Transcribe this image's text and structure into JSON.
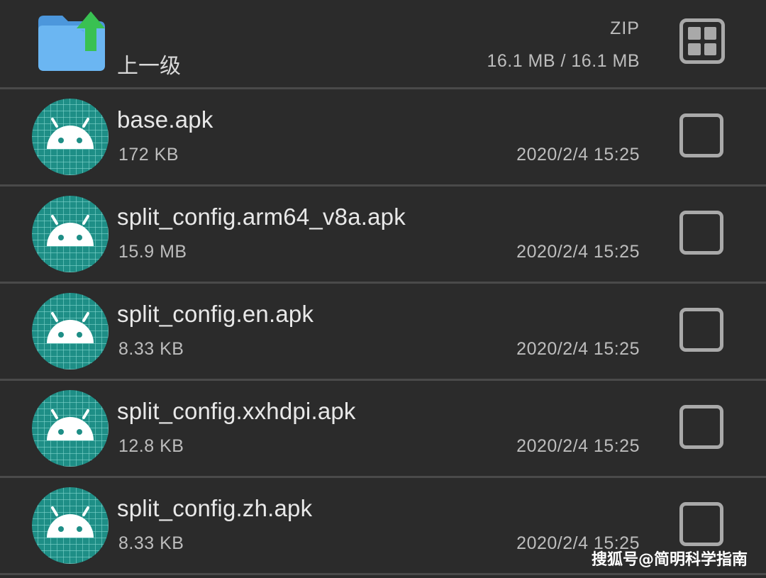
{
  "colors": {
    "background": "#2b2b2b",
    "divider": "#4a4a4a",
    "apk_icon_bg": "#1e8e86",
    "apk_icon_grid": "#7fd3cb",
    "android_head": "#ffffff",
    "folder": "#5aa9ec",
    "upload_arrow": "#39c152",
    "checkbox": "#a9a9a9"
  },
  "header": {
    "label": "上一级",
    "icon": "folder-up-icon",
    "type": "ZIP",
    "size": "16.1 MB / 16.1 MB",
    "view_toggle_icon": "grid-view-icon"
  },
  "files": [
    {
      "name": "base.apk",
      "size": "172 KB",
      "date": "2020/2/4  15:25",
      "icon": "android-apk-icon",
      "checked": false
    },
    {
      "name": "split_config.arm64_v8a.apk",
      "size": "15.9 MB",
      "date": "2020/2/4  15:25",
      "icon": "android-apk-icon",
      "checked": false
    },
    {
      "name": "split_config.en.apk",
      "size": "8.33 KB",
      "date": "2020/2/4  15:25",
      "icon": "android-apk-icon",
      "checked": false
    },
    {
      "name": "split_config.xxhdpi.apk",
      "size": "12.8 KB",
      "date": "2020/2/4  15:25",
      "icon": "android-apk-icon",
      "checked": false
    },
    {
      "name": "split_config.zh.apk",
      "size": "8.33 KB",
      "date": "2020/2/4  15:25",
      "icon": "android-apk-icon",
      "checked": false
    }
  ],
  "watermark": "搜狐号@简明科学指南"
}
